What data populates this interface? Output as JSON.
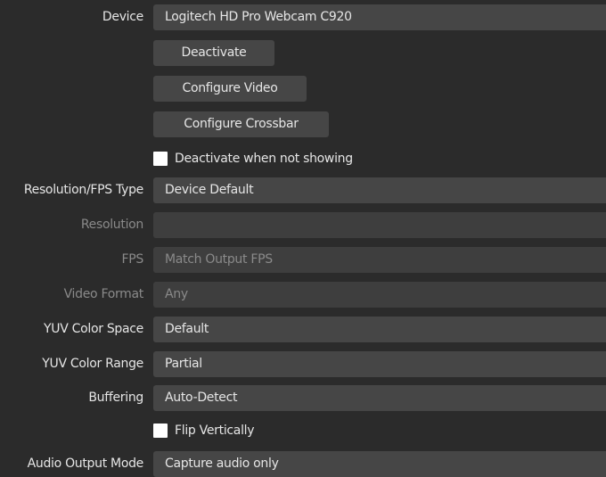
{
  "device": {
    "label": "Device",
    "value": "Logitech HD Pro Webcam C920"
  },
  "buttons": {
    "deactivate": "Deactivate",
    "configure_video": "Configure Video",
    "configure_crossbar": "Configure Crossbar"
  },
  "deactivate_when_not_showing": {
    "label": "Deactivate when not showing",
    "checked": false
  },
  "resolution_fps_type": {
    "label": "Resolution/FPS Type",
    "value": "Device Default"
  },
  "resolution": {
    "label": "Resolution",
    "value": ""
  },
  "fps": {
    "label": "FPS",
    "value": "Match Output FPS"
  },
  "video_format": {
    "label": "Video Format",
    "value": "Any"
  },
  "yuv_color_space": {
    "label": "YUV Color Space",
    "value": "Default"
  },
  "yuv_color_range": {
    "label": "YUV Color Range",
    "value": "Partial"
  },
  "buffering": {
    "label": "Buffering",
    "value": "Auto-Detect"
  },
  "flip_vertically": {
    "label": "Flip Vertically",
    "checked": false
  },
  "audio_output_mode": {
    "label": "Audio Output Mode",
    "value": "Capture audio only"
  }
}
